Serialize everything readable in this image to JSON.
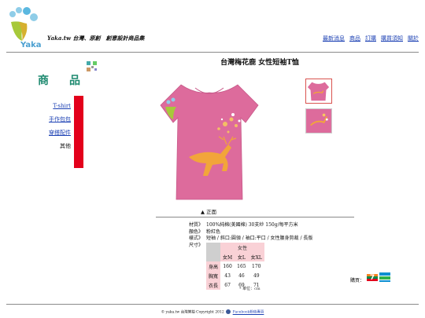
{
  "header": {
    "site_tag": "Yaka.tw 台灣、原創　創意設計商品集",
    "logo_text": "Yaka",
    "nav": [
      {
        "label": "最新消息"
      },
      {
        "label": "商品"
      },
      {
        "label": "訂購"
      },
      {
        "label": "購買須知"
      },
      {
        "label": "關於"
      }
    ]
  },
  "sidebar": {
    "heading": "商品",
    "categories": [
      {
        "label": "T-shirt",
        "link": true
      },
      {
        "label": "手作包包",
        "link": true
      },
      {
        "label": "穿搭配件",
        "link": true
      },
      {
        "label": "其他",
        "link": false
      }
    ]
  },
  "product": {
    "title": "台灣梅花鹿 女性短袖T恤",
    "view_label": "▲ 正面",
    "shirt_color": "#dd6b9c",
    "image_caption": "yaka.tw Copyright 2012",
    "specs": {
      "labels": [
        "材質》",
        "顏色》",
        "樣式》",
        "尺寸》"
      ],
      "values": [
        "100%純棉(美國棉) 30支紗 150g/每平方米",
        "粉紅色",
        "短袖 / 斜口:圓領 / 袖口:平口 / 女性腰身剪裁 / 長版",
        ""
      ]
    },
    "size_table": {
      "group": "女性",
      "sizes": [
        "女M",
        "女L",
        "女XL"
      ],
      "rows": [
        {
          "label": "身高",
          "values": [
            "160",
            "165",
            "170"
          ]
        },
        {
          "label": "胸寬",
          "values": [
            "43",
            "46",
            "49"
          ]
        },
        {
          "label": "衣長",
          "values": [
            "67",
            "69",
            "71"
          ]
        }
      ],
      "unit_note": "* 單位：cm"
    },
    "purchase_label": "購買："
  },
  "footer": {
    "copyright": "© yaka.tw 台灣樂拍 Copyright 2012",
    "facebook_link": "Facebook粉絲專頁"
  },
  "colors": {
    "accent_red": "#e3001b",
    "link_blue": "#1a3fb3",
    "heading_green": "#1e8a70",
    "table_pink": "#f9d1d6"
  }
}
